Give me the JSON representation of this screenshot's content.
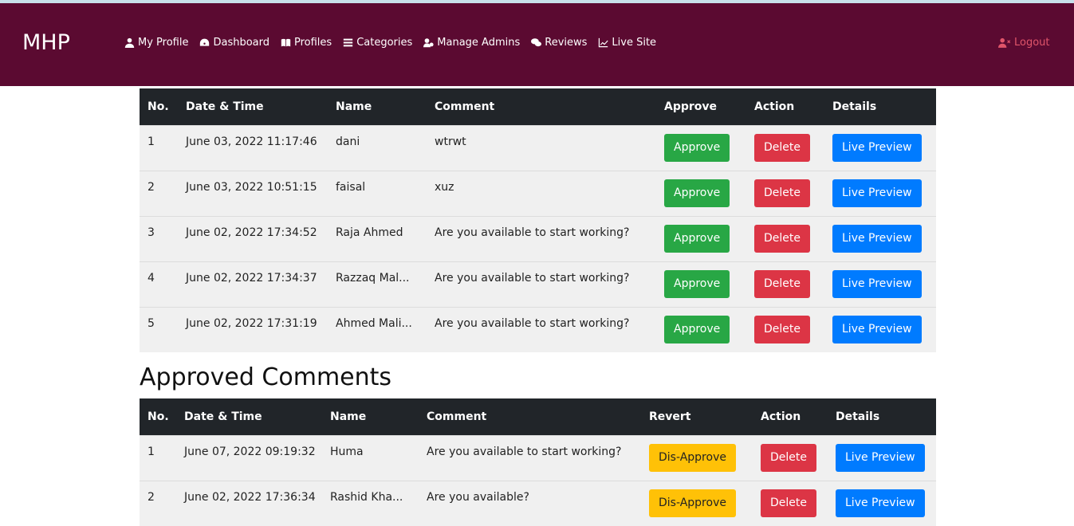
{
  "brand": "MHP",
  "nav": [
    {
      "label": "My Profile",
      "icon": "user-icon"
    },
    {
      "label": "Dashboard",
      "icon": "dashboard-icon"
    },
    {
      "label": "Profiles",
      "icon": "book-icon"
    },
    {
      "label": "Categories",
      "icon": "list-icon"
    },
    {
      "label": "Manage Admins",
      "icon": "admins-icon"
    },
    {
      "label": "Reviews",
      "icon": "comments-icon"
    },
    {
      "label": "Live Site",
      "icon": "chart-icon"
    }
  ],
  "logout": "Logout",
  "pending": {
    "headers": [
      "No.",
      "Date & Time",
      "Name",
      "Comment",
      "Approve",
      "Action",
      "Details"
    ],
    "rows": [
      {
        "no": "1",
        "date": "June 03, 2022 11:17:46",
        "name": "dani",
        "comment": "wtrwt"
      },
      {
        "no": "2",
        "date": "June 03, 2022 10:51:15",
        "name": "faisal",
        "comment": "xuz"
      },
      {
        "no": "3",
        "date": "June 02, 2022 17:34:52",
        "name": "Raja Ahmed",
        "comment": "Are you available to start working?"
      },
      {
        "no": "4",
        "date": "June 02, 2022 17:34:37",
        "name": "Razzaq Mal...",
        "comment": "Are you available to start working?"
      },
      {
        "no": "5",
        "date": "June 02, 2022 17:31:19",
        "name": "Ahmed Mali...",
        "comment": "Are you available to start working?"
      }
    ],
    "approve_label": "Approve",
    "delete_label": "Delete",
    "preview_label": "Live Preview"
  },
  "approved": {
    "title": "Approved Comments",
    "headers": [
      "No.",
      "Date & Time",
      "Name",
      "Comment",
      "Revert",
      "Action",
      "Details"
    ],
    "rows": [
      {
        "no": "1",
        "date": "June 07, 2022 09:19:32",
        "name": "Huma",
        "comment": "Are you available to start working?"
      },
      {
        "no": "2",
        "date": "June 02, 2022 17:36:34",
        "name": "Rashid Kha...",
        "comment": "Are you available?"
      }
    ],
    "revert_label": "Dis-Approve",
    "delete_label": "Delete",
    "preview_label": "Live Preview"
  }
}
